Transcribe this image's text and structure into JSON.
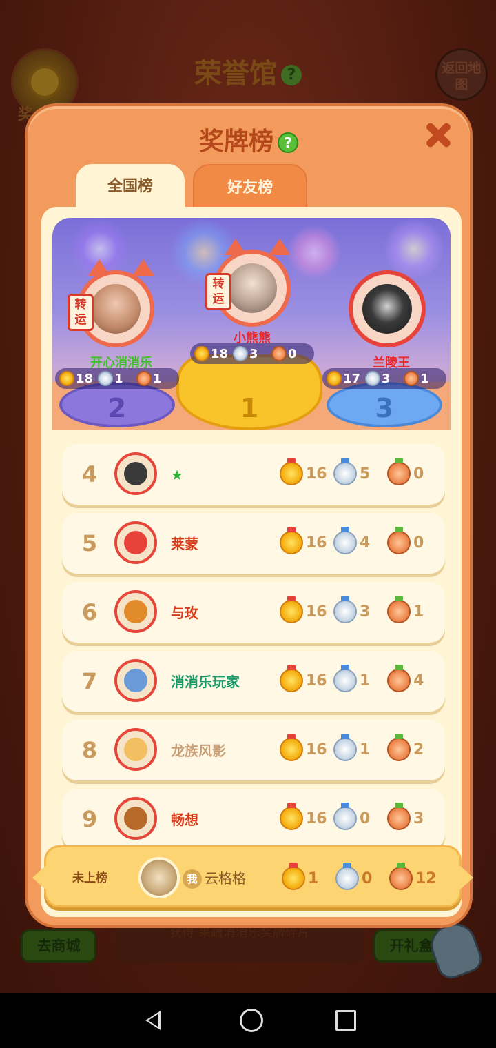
{
  "background": {
    "title": "荣誉馆",
    "help_icon": "question-icon",
    "medal_label": "奖",
    "subtitle": "",
    "map_button": "返回地图",
    "shop_button": "去商城",
    "gift_button": "开礼盒",
    "hint_text": "获得 果蔬消消乐奖牌碎片"
  },
  "modal": {
    "title": "奖牌榜",
    "help_icon": "question-icon",
    "close_icon": "close-icon",
    "tabs": [
      {
        "label": "全国榜",
        "active": true
      },
      {
        "label": "好友榜",
        "active": false
      }
    ]
  },
  "podium": [
    {
      "rank": "1",
      "name": "小熊熊",
      "gold": "18",
      "silver": "3",
      "bronze": "0",
      "charm": "转运"
    },
    {
      "rank": "2",
      "name": "开心消消乐",
      "gold": "18",
      "silver": "1",
      "bronze": "1",
      "charm": "转运"
    },
    {
      "rank": "3",
      "name": "兰陵王",
      "gold": "17",
      "silver": "3",
      "bronze": "1"
    }
  ],
  "ranking": [
    {
      "rank": "4",
      "name": "★",
      "name_color": "#2ab43a",
      "gold": "16",
      "silver": "5",
      "bronze": "0",
      "avatar_color": "#3a3a3a"
    },
    {
      "rank": "5",
      "name": "莱蒙",
      "name_color": "#d83a1a",
      "gold": "16",
      "silver": "4",
      "bronze": "0",
      "avatar_color": "#e8433a"
    },
    {
      "rank": "6",
      "name": "与玫",
      "name_color": "#d83a1a",
      "gold": "16",
      "silver": "3",
      "bronze": "1",
      "avatar_color": "#e08a2a"
    },
    {
      "rank": "7",
      "name": "消消乐玩家",
      "name_color": "#1a9a6a",
      "gold": "16",
      "silver": "1",
      "bronze": "4",
      "avatar_color": "#6a9ad8"
    },
    {
      "rank": "8",
      "name": "龙族风影",
      "name_color": "#c8a078",
      "gold": "16",
      "silver": "1",
      "bronze": "2",
      "avatar_color": "#f2c060"
    },
    {
      "rank": "9",
      "name": "畅想",
      "name_color": "#d83a1a",
      "gold": "16",
      "silver": "0",
      "bronze": "3",
      "avatar_color": "#b86a2a"
    }
  ],
  "me": {
    "rank_label": "未上榜",
    "badge": "我",
    "name": "云格格",
    "gold": "1",
    "silver": "0",
    "bronze": "12"
  },
  "navbar": {
    "back_icon": "back-triangle-icon",
    "home_icon": "home-circle-icon",
    "recent_icon": "recent-square-icon"
  }
}
